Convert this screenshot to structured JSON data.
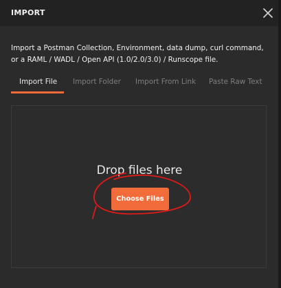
{
  "dialog": {
    "title": "IMPORT",
    "close_icon": "close-icon",
    "description": "Import a Postman Collection, Environment, data dump, curl command, or a RAML / WADL / Open API (1.0/2.0/3.0) / Runscope file."
  },
  "tabs": [
    {
      "label": "Import File",
      "active": true
    },
    {
      "label": "Import Folder",
      "active": false
    },
    {
      "label": "Import From Link",
      "active": false
    },
    {
      "label": "Paste Raw Text",
      "active": false
    }
  ],
  "dropzone": {
    "text": "Drop files here",
    "button_label": "Choose Files"
  },
  "colors": {
    "accent": "#f26b3a",
    "annotation": "#e01919",
    "background": "#2b2b2b"
  }
}
